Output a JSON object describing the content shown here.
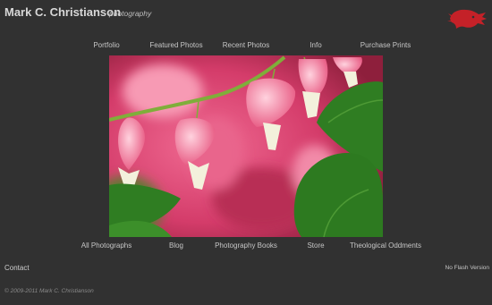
{
  "site": {
    "name": "Mark C. Christianson",
    "tagline": "photography"
  },
  "nav_top": [
    {
      "label": "Portfolio"
    },
    {
      "label": "Featured Photos"
    },
    {
      "label": "Recent Photos"
    },
    {
      "label": "Info"
    },
    {
      "label": "Purchase Prints"
    }
  ],
  "nav_bottom": [
    {
      "label": "All Photographs"
    },
    {
      "label": "Blog"
    },
    {
      "label": "Photography Books"
    },
    {
      "label": "Store"
    },
    {
      "label": "Theological Oddments"
    }
  ],
  "footer": {
    "contact": "Contact",
    "no_flash": "No Flash Version",
    "copyright": "© 2009-2011 Mark C. Christianson"
  },
  "colors": {
    "background": "#313131",
    "logo_red": "#c42128"
  },
  "icons": {
    "logo": "red-lion-head"
  }
}
